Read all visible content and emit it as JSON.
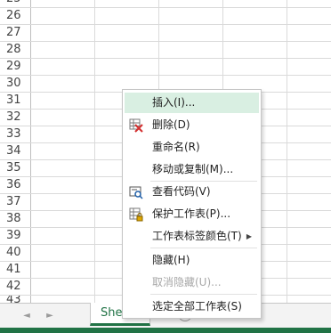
{
  "rows": [
    "25",
    "26",
    "27",
    "28",
    "29",
    "30",
    "31",
    "32",
    "33",
    "34",
    "35",
    "36",
    "37",
    "38",
    "39",
    "40",
    "41",
    "42",
    "43",
    "44"
  ],
  "tab_nav": {
    "prev": "◄",
    "next": "►"
  },
  "sheet_tab": {
    "label": "Shee"
  },
  "context_menu": {
    "items": [
      {
        "label": "插入(I)...",
        "icon": "",
        "state": "hover"
      },
      {
        "label": "删除(D)",
        "icon": "delete-sheet-icon",
        "state": "normal"
      },
      {
        "label": "重命名(R)",
        "icon": "",
        "state": "normal"
      },
      {
        "label": "移动或复制(M)...",
        "icon": "",
        "state": "normal"
      },
      {
        "label": "查看代码(V)",
        "icon": "view-code-icon",
        "state": "normal"
      },
      {
        "label": "保护工作表(P)...",
        "icon": "protect-sheet-icon",
        "state": "normal"
      },
      {
        "label": "工作表标签颜色(T)",
        "icon": "",
        "state": "normal",
        "submenu": true
      },
      {
        "label": "隐藏(H)",
        "icon": "",
        "state": "normal"
      },
      {
        "label": "取消隐藏(U)...",
        "icon": "",
        "state": "disabled"
      },
      {
        "label": "选定全部工作表(S)",
        "icon": "",
        "state": "normal"
      }
    ],
    "submenu_arrow": "▶"
  },
  "colors": {
    "accent": "#217346",
    "hover": "#d9efe2",
    "grid": "#dadada"
  }
}
